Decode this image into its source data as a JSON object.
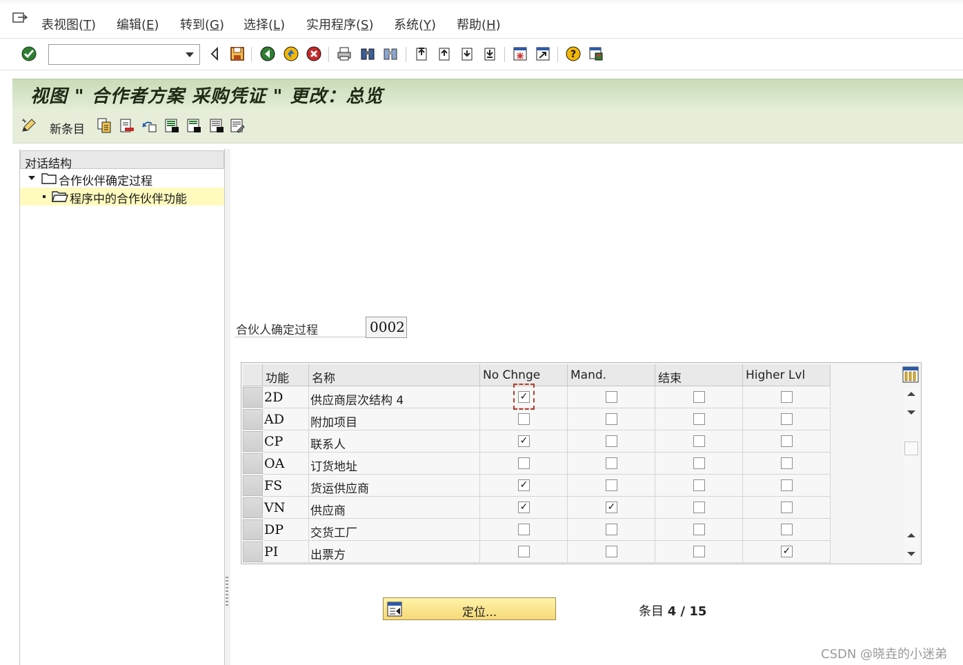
{
  "menu": {
    "items": [
      {
        "label": "表视图(",
        "key": "T",
        "suffix": ")"
      },
      {
        "label": "编辑(",
        "key": "E",
        "suffix": ")"
      },
      {
        "label": "转到(",
        "key": "G",
        "suffix": ")"
      },
      {
        "label": "选择(",
        "key": "L",
        "suffix": ")"
      },
      {
        "label": "实用程序(",
        "key": "S",
        "suffix": ")"
      },
      {
        "label": "系统(",
        "key": "Y",
        "suffix": ")"
      },
      {
        "label": "帮助(",
        "key": "H",
        "suffix": ")"
      }
    ]
  },
  "toolbar": {
    "command_value": ""
  },
  "title": "视图 \" 合作者方案 采购凭证 \" 更改：总览",
  "app_toolbar": {
    "new_entry_label": "新条目"
  },
  "tree": {
    "header": "对话结构",
    "items": [
      {
        "label": "合作伙伴确定过程",
        "expanded": true,
        "selected": false
      },
      {
        "label": "程序中的合作伙伴功能",
        "expanded": false,
        "selected": true
      }
    ]
  },
  "field": {
    "label": "合伙人确定过程",
    "value": "0002"
  },
  "table": {
    "headers": [
      "功能",
      "名称",
      "No Chnge",
      "Mand.",
      "结束",
      "Higher Lvl"
    ],
    "rows": [
      {
        "code": "2D",
        "name": "供应商层次结构 4",
        "no_change": true,
        "mand": false,
        "end": false,
        "higher": false
      },
      {
        "code": "AD",
        "name": "附加项目",
        "no_change": false,
        "mand": false,
        "end": false,
        "higher": false
      },
      {
        "code": "CP",
        "name": "联系人",
        "no_change": true,
        "mand": false,
        "end": false,
        "higher": false
      },
      {
        "code": "OA",
        "name": "订货地址",
        "no_change": false,
        "mand": false,
        "end": false,
        "higher": false
      },
      {
        "code": "FS",
        "name": "货运供应商",
        "no_change": true,
        "mand": false,
        "end": false,
        "higher": false
      },
      {
        "code": "VN",
        "name": "供应商",
        "no_change": true,
        "mand": true,
        "end": false,
        "higher": false
      },
      {
        "code": "DP",
        "name": "交货工厂",
        "no_change": false,
        "mand": false,
        "end": false,
        "higher": false
      },
      {
        "code": "PI",
        "name": "出票方",
        "no_change": false,
        "mand": false,
        "end": false,
        "higher": true
      }
    ]
  },
  "bottom": {
    "position_button_label": "定位...",
    "entry_label": "条目",
    "entry_position": "4 / 15"
  },
  "watermark": "CSDN @晓垚的小迷弟",
  "colors": {
    "title_bg": "#c9dcb8",
    "app_toolbar_bg": "#e6edd9",
    "selected_tree_bg": "#fffbbf",
    "button_bg": "#f6d979",
    "focus_frame": "#b23a2a"
  },
  "icons": {
    "toolbar": [
      "enter-check-icon",
      "back-nav-icon",
      "save-icon",
      "back-icon",
      "exit-icon",
      "cancel-icon",
      "print-icon",
      "find-icon",
      "find-next-icon",
      "first-page-icon",
      "previous-page-icon",
      "next-page-icon",
      "last-page-icon",
      "create-session-icon",
      "shortcut-icon",
      "help-icon",
      "layout-icon"
    ],
    "app_toolbar": [
      "edit-pencil-icon",
      "copy-as-icon",
      "delete-icon",
      "undo-change-icon",
      "select-all-icon",
      "select-block-icon",
      "deselect-all-icon",
      "details-icon"
    ]
  }
}
